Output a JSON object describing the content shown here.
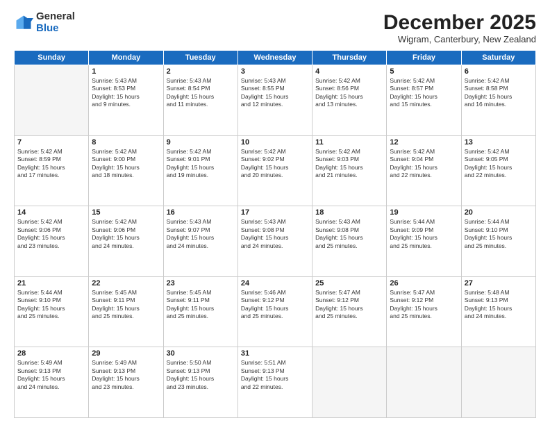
{
  "logo": {
    "general": "General",
    "blue": "Blue"
  },
  "header": {
    "month": "December 2025",
    "location": "Wigram, Canterbury, New Zealand"
  },
  "weekdays": [
    "Sunday",
    "Monday",
    "Tuesday",
    "Wednesday",
    "Thursday",
    "Friday",
    "Saturday"
  ],
  "weeks": [
    [
      {
        "day": "",
        "empty": true
      },
      {
        "day": "1",
        "sunrise": "5:43 AM",
        "sunset": "8:53 PM",
        "daylight": "15 hours and 9 minutes."
      },
      {
        "day": "2",
        "sunrise": "5:43 AM",
        "sunset": "8:54 PM",
        "daylight": "15 hours and 11 minutes."
      },
      {
        "day": "3",
        "sunrise": "5:43 AM",
        "sunset": "8:55 PM",
        "daylight": "15 hours and 12 minutes."
      },
      {
        "day": "4",
        "sunrise": "5:42 AM",
        "sunset": "8:56 PM",
        "daylight": "15 hours and 13 minutes."
      },
      {
        "day": "5",
        "sunrise": "5:42 AM",
        "sunset": "8:57 PM",
        "daylight": "15 hours and 15 minutes."
      },
      {
        "day": "6",
        "sunrise": "5:42 AM",
        "sunset": "8:58 PM",
        "daylight": "15 hours and 16 minutes."
      }
    ],
    [
      {
        "day": "7",
        "sunrise": "5:42 AM",
        "sunset": "8:59 PM",
        "daylight": "15 hours and 17 minutes."
      },
      {
        "day": "8",
        "sunrise": "5:42 AM",
        "sunset": "9:00 PM",
        "daylight": "15 hours and 18 minutes."
      },
      {
        "day": "9",
        "sunrise": "5:42 AM",
        "sunset": "9:01 PM",
        "daylight": "15 hours and 19 minutes."
      },
      {
        "day": "10",
        "sunrise": "5:42 AM",
        "sunset": "9:02 PM",
        "daylight": "15 hours and 20 minutes."
      },
      {
        "day": "11",
        "sunrise": "5:42 AM",
        "sunset": "9:03 PM",
        "daylight": "15 hours and 21 minutes."
      },
      {
        "day": "12",
        "sunrise": "5:42 AM",
        "sunset": "9:04 PM",
        "daylight": "15 hours and 22 minutes."
      },
      {
        "day": "13",
        "sunrise": "5:42 AM",
        "sunset": "9:05 PM",
        "daylight": "15 hours and 22 minutes."
      }
    ],
    [
      {
        "day": "14",
        "sunrise": "5:42 AM",
        "sunset": "9:06 PM",
        "daylight": "15 hours and 23 minutes."
      },
      {
        "day": "15",
        "sunrise": "5:42 AM",
        "sunset": "9:06 PM",
        "daylight": "15 hours and 24 minutes."
      },
      {
        "day": "16",
        "sunrise": "5:43 AM",
        "sunset": "9:07 PM",
        "daylight": "15 hours and 24 minutes."
      },
      {
        "day": "17",
        "sunrise": "5:43 AM",
        "sunset": "9:08 PM",
        "daylight": "15 hours and 24 minutes."
      },
      {
        "day": "18",
        "sunrise": "5:43 AM",
        "sunset": "9:08 PM",
        "daylight": "15 hours and 25 minutes."
      },
      {
        "day": "19",
        "sunrise": "5:44 AM",
        "sunset": "9:09 PM",
        "daylight": "15 hours and 25 minutes."
      },
      {
        "day": "20",
        "sunrise": "5:44 AM",
        "sunset": "9:10 PM",
        "daylight": "15 hours and 25 minutes."
      }
    ],
    [
      {
        "day": "21",
        "sunrise": "5:44 AM",
        "sunset": "9:10 PM",
        "daylight": "15 hours and 25 minutes."
      },
      {
        "day": "22",
        "sunrise": "5:45 AM",
        "sunset": "9:11 PM",
        "daylight": "15 hours and 25 minutes."
      },
      {
        "day": "23",
        "sunrise": "5:45 AM",
        "sunset": "9:11 PM",
        "daylight": "15 hours and 25 minutes."
      },
      {
        "day": "24",
        "sunrise": "5:46 AM",
        "sunset": "9:12 PM",
        "daylight": "15 hours and 25 minutes."
      },
      {
        "day": "25",
        "sunrise": "5:47 AM",
        "sunset": "9:12 PM",
        "daylight": "15 hours and 25 minutes."
      },
      {
        "day": "26",
        "sunrise": "5:47 AM",
        "sunset": "9:12 PM",
        "daylight": "15 hours and 25 minutes."
      },
      {
        "day": "27",
        "sunrise": "5:48 AM",
        "sunset": "9:13 PM",
        "daylight": "15 hours and 24 minutes."
      }
    ],
    [
      {
        "day": "28",
        "sunrise": "5:49 AM",
        "sunset": "9:13 PM",
        "daylight": "15 hours and 24 minutes."
      },
      {
        "day": "29",
        "sunrise": "5:49 AM",
        "sunset": "9:13 PM",
        "daylight": "15 hours and 23 minutes."
      },
      {
        "day": "30",
        "sunrise": "5:50 AM",
        "sunset": "9:13 PM",
        "daylight": "15 hours and 23 minutes."
      },
      {
        "day": "31",
        "sunrise": "5:51 AM",
        "sunset": "9:13 PM",
        "daylight": "15 hours and 22 minutes."
      },
      {
        "day": "",
        "empty": true
      },
      {
        "day": "",
        "empty": true
      },
      {
        "day": "",
        "empty": true
      }
    ]
  ]
}
